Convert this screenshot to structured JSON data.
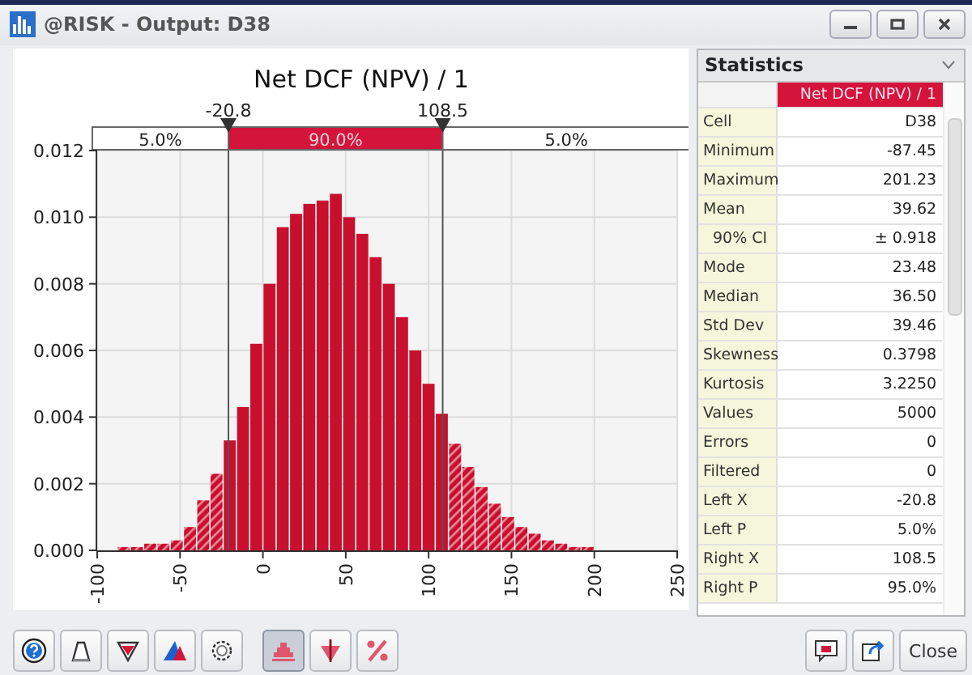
{
  "window": {
    "title": "@RISK - Output: D38"
  },
  "chart": {
    "probability_bar": [
      {
        "label": "5.0%",
        "selected": false
      },
      {
        "label": "90.0%",
        "selected": true
      },
      {
        "label": "5.0%",
        "selected": false
      }
    ],
    "chart_data": {
      "type": "bar",
      "title": "Net DCF (NPV) / 1",
      "x": [
        -84,
        -76,
        -68,
        -60,
        -52,
        -44,
        -36,
        -28,
        -20,
        -12,
        -4,
        4,
        12,
        20,
        28,
        36,
        44,
        52,
        60,
        68,
        76,
        84,
        92,
        100,
        108,
        116,
        124,
        132,
        140,
        148,
        156,
        164,
        172,
        180,
        188,
        196
      ],
      "series": [
        {
          "color": "#c8102e",
          "values": [
            0.0001,
            0.0001,
            0.0002,
            0.0002,
            0.0003,
            0.0007,
            0.0015,
            0.0023,
            0.0033,
            0.0043,
            0.0062,
            0.008,
            0.0097,
            0.0101,
            0.0104,
            0.0105,
            0.0107,
            0.01,
            0.0095,
            0.0088,
            0.008,
            0.007,
            0.006,
            0.005,
            0.0041,
            0.0032,
            0.0025,
            0.0019,
            0.0014,
            0.001,
            0.0007,
            0.0005,
            0.0003,
            0.0002,
            0.0001,
            0.0001
          ]
        }
      ],
      "xlim": [
        -100,
        250
      ],
      "ylim": [
        0,
        0.012
      ],
      "xticks": [
        -100,
        -50,
        0,
        50,
        100,
        150,
        200,
        250
      ],
      "yticks": [
        {
          "value": 0,
          "label": "0.000"
        },
        {
          "value": 0.002,
          "label": "0.002"
        },
        {
          "value": 0.004,
          "label": "0.004"
        },
        {
          "value": 0.006,
          "label": "0.006"
        },
        {
          "value": 0.008,
          "label": "0.008"
        },
        {
          "value": 0.01,
          "label": "0.010"
        },
        {
          "value": 0.012,
          "label": "0.012"
        }
      ],
      "grid": true,
      "ref_lines": [
        {
          "axis": "x",
          "value": -20.8,
          "label": "-20.8"
        },
        {
          "axis": "x",
          "value": 108.5,
          "label": "108.5"
        }
      ]
    }
  },
  "statistics": {
    "title": "Statistics",
    "column": "Net DCF (NPV) / 1",
    "rows": [
      {
        "label": "Cell",
        "value": "D38"
      },
      {
        "label": "Minimum",
        "value": "-87.45"
      },
      {
        "label": "Maximum",
        "value": "201.23"
      },
      {
        "label": "Mean",
        "value": "39.62",
        "children": [
          {
            "label": "90% CI",
            "value": "± 0.918"
          }
        ]
      },
      {
        "label": "Mode",
        "value": "23.48"
      },
      {
        "label": "Median",
        "value": "36.50"
      },
      {
        "label": "Std Dev",
        "value": "39.46"
      },
      {
        "label": "Skewness",
        "value": "0.3798"
      },
      {
        "label": "Kurtosis",
        "value": "3.2250"
      },
      {
        "label": "Values",
        "value": "5000"
      },
      {
        "label": "Errors",
        "value": "0"
      },
      {
        "label": "Filtered",
        "value": "0"
      },
      {
        "label": "Left X",
        "value": "-20.8"
      },
      {
        "label": "Left P",
        "value": "5.0%"
      },
      {
        "label": "Right X",
        "value": "108.5"
      },
      {
        "label": "Right P",
        "value": "95.0%"
      }
    ]
  },
  "toolbar": {
    "tools": [
      {
        "kind": "help",
        "selected": false
      },
      {
        "kind": "bell",
        "selected": false
      },
      {
        "kind": "filter",
        "selected": false
      },
      {
        "kind": "overlay",
        "selected": false
      },
      {
        "kind": "settings",
        "selected": false
      }
    ],
    "views": [
      {
        "kind": "histogram",
        "selected": true
      },
      {
        "kind": "tornado",
        "selected": false
      },
      {
        "kind": "percent",
        "selected": false
      }
    ],
    "actions": [
      {
        "kind": "comment"
      },
      {
        "kind": "export"
      },
      {
        "kind": "text",
        "label": "Close"
      }
    ]
  }
}
